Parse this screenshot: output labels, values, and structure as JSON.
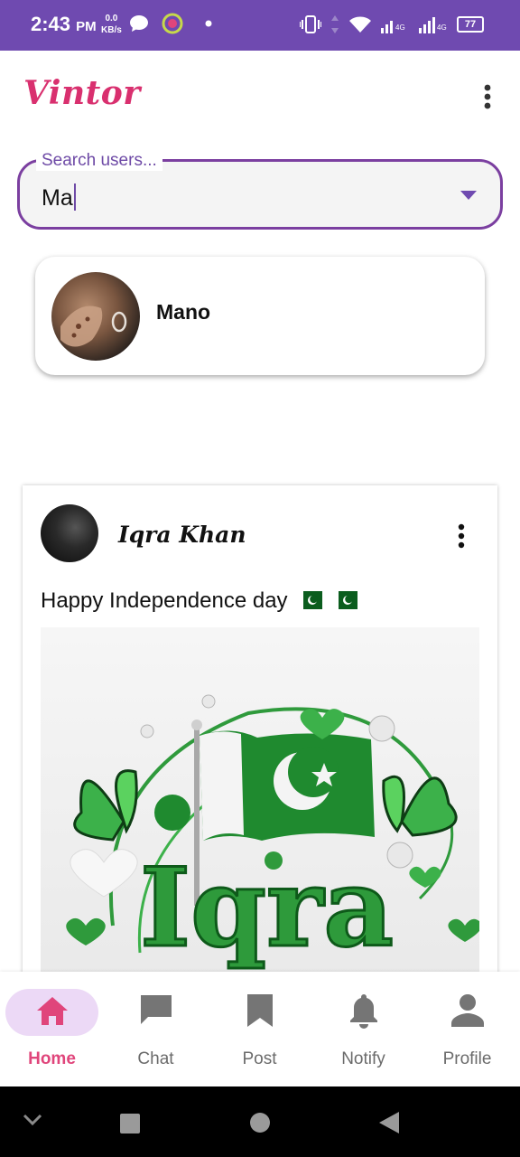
{
  "status_bar": {
    "time": "2:43",
    "ampm": "PM",
    "speed_value": "0.0",
    "speed_unit": "KB/s",
    "network_1": "4G",
    "network_2": "4G",
    "battery": "77"
  },
  "app": {
    "title": "Vintor",
    "brand_color": "#d9306f",
    "accent_color": "#6f4ab0"
  },
  "search": {
    "label": "Search users...",
    "value": "Ma"
  },
  "suggestions": [
    {
      "name": "Mano"
    }
  ],
  "post": {
    "author": "Iqra Khan",
    "caption": "Happy Independence day",
    "caption_emojis": [
      "pakistan-flag",
      "pakistan-flag"
    ],
    "image_text": "Iqra"
  },
  "bottom_nav": {
    "items": [
      {
        "label": "Home",
        "icon": "home-icon",
        "active": true
      },
      {
        "label": "Chat",
        "icon": "chat-icon",
        "active": false
      },
      {
        "label": "Post",
        "icon": "bookmark-icon",
        "active": false
      },
      {
        "label": "Notify",
        "icon": "bell-icon",
        "active": false
      },
      {
        "label": "Profile",
        "icon": "person-icon",
        "active": false
      }
    ]
  }
}
